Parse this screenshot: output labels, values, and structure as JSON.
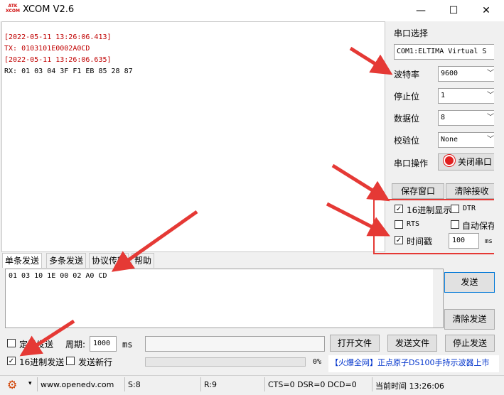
{
  "window": {
    "logo_line1": "ATK",
    "logo_line2": "XCOM",
    "title": "XCOM V2.6",
    "minimize_symbol": "—",
    "maximize_symbol": "☐",
    "close_symbol": "✕"
  },
  "receive": {
    "lines": [
      {
        "text": "[2022-05-11 13:26:06.413]",
        "color": "red"
      },
      {
        "text": "TX: 0103101E0002A0CD",
        "color": "red"
      },
      {
        "text": "[2022-05-11 13:26:06.635]",
        "color": "red"
      },
      {
        "text": "RX: 01 03 04 3F F1 EB 85 28 87",
        "color": "black"
      }
    ]
  },
  "settings": {
    "port_select_label": "串口选择",
    "port_value": "COM1:ELTIMA Virtual S",
    "baud_label": "波特率",
    "baud_value": "9600",
    "stopbits_label": "停止位",
    "stopbits_value": "1",
    "databits_label": "数据位",
    "databits_value": "8",
    "parity_label": "校验位",
    "parity_value": "None",
    "port_op_label": "串口操作",
    "port_op_button": "关闭串口",
    "save_window": "保存窗口",
    "clear_receive": "清除接收",
    "hex_display": "16进制显示",
    "hex_display_checked": true,
    "dtr": "DTR",
    "dtr_checked": false,
    "rts": "RTS",
    "rts_checked": false,
    "auto_save": "自动保存",
    "auto_save_checked": false,
    "timestamp": "时间戳",
    "timestamp_checked": true,
    "timestamp_interval": "100",
    "timestamp_unit": "ms"
  },
  "tabs": [
    "单条发送",
    "多条发送",
    "协议传输",
    "帮助"
  ],
  "send": {
    "text": "01 03 10 1E 00 02 A0 CD",
    "send_button": "发送",
    "clear_send_button": "清除发送",
    "timed_send": "定时发送",
    "timed_send_checked": false,
    "period_label": "周期:",
    "period_value": "1000",
    "period_unit": "ms",
    "open_file": "打开文件",
    "send_file": "发送文件",
    "stop_send": "停止发送",
    "hex_send": "16进制发送",
    "hex_send_checked": true,
    "send_newline": "发送新行",
    "send_newline_checked": false,
    "progress_percent": "0%",
    "progress_value": 0,
    "ad_text_1": "【火爆全网】",
    "ad_text_2": "正点原子DS100手持示波器上市"
  },
  "statusbar": {
    "url": "www.openedv.com",
    "sent": "S:8",
    "received": "R:9",
    "signals": "CTS=0 DSR=0 DCD=0",
    "time": "当前时间 13:26:06"
  },
  "colors": {
    "accent": "#e53935",
    "ad_blue": "#0033cc",
    "ad_red": "#d01010",
    "timestamp_red": "#c00000"
  }
}
